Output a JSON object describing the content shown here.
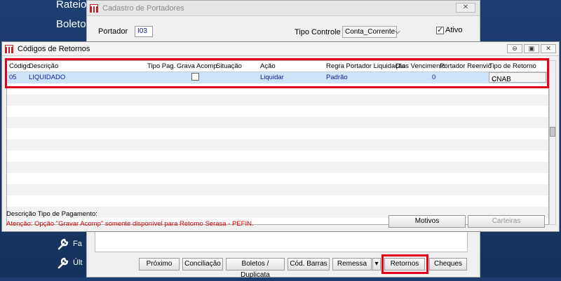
{
  "background": {
    "nav_items": [
      "Rateios",
      "Boletos"
    ],
    "tools": [
      {
        "icon": "wrench-icon",
        "label": "Fa"
      },
      {
        "icon": "wrench-icon",
        "label": "Últ"
      }
    ]
  },
  "back_dialog": {
    "title": "Cadastro de Portadores",
    "close": "✕",
    "portador_label": "Portador",
    "portador_value": "I03",
    "tipo_controle_label": "Tipo Controle",
    "tipo_controle_value": "Conta_Corrente",
    "ativo_label": "Ativo",
    "buttons": {
      "proximo": "Próximo",
      "conciliacao": "Conciliação",
      "boletos": "Boletos / Duplicata",
      "cod_barras": "Cód. Barras",
      "remessa": "Remessa",
      "retornos": "Retornos",
      "cheques": "Cheques"
    }
  },
  "front_dialog": {
    "title": "Códigos de Retornos",
    "columns": [
      "Código",
      "Descrição",
      "Tipo Pag.",
      "Grava Acomp.",
      "Situação",
      "Ação",
      "Regra Portador Liquidação",
      "Dias Vencimento",
      "Portador Reenvio",
      "Tipo de Retorno"
    ],
    "row": {
      "codigo": "05",
      "descricao": "LIQUIDADO",
      "acao": "Liquidar",
      "regra": "Padrão",
      "dias": "0",
      "tipo_retorno": "CNAB"
    },
    "desc_label": "Descrição Tipo de Pagamento:",
    "warning": "Atenção: Opção \"Gravar Acomp\" somente disponível para Retorno Serasa - PEFIN.",
    "buttons": {
      "motivos": "Motivos",
      "carteiras": "Carteiras"
    }
  },
  "colors": {
    "highlight": "#e4001b",
    "selected_row": "#cce3f9",
    "link_text": "#1020a0",
    "warning": "#d40000"
  }
}
